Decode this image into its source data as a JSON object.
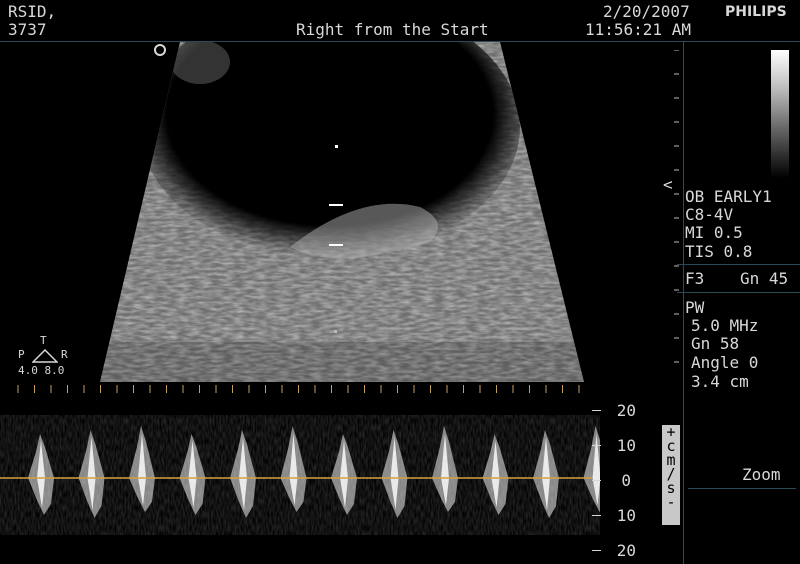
{
  "header": {
    "rsid_label": "RSID,",
    "rsid_value": "3737",
    "title": "Right from the Start",
    "date": "2/20/2007",
    "time": "11:56:21 AM",
    "brand": "PHILIPS"
  },
  "orientation": {
    "top": "T",
    "left": "P",
    "right": "R",
    "values": "4.0 8.0"
  },
  "settings": {
    "preset": "OB EARLY1",
    "transducer": "C8-4V",
    "mi": "MI 0.5",
    "tis": "TIS 0.8",
    "freq_mode": "F3",
    "gain2d": "Gn 45",
    "mode": "PW",
    "pw_freq": "5.0 MHz",
    "pw_gain": "Gn 58",
    "angle": "Angle 0",
    "depth": "3.4 cm",
    "zoom_label": "Zoom",
    "focus_marker": "<"
  },
  "doppler": {
    "scale_labels": [
      "20",
      "10",
      "0",
      "10",
      "20"
    ],
    "unit_chars": [
      "+",
      "c",
      "m",
      "/",
      "s",
      "-"
    ],
    "baseline_color": "#d8a040"
  },
  "icons": {
    "probe_marker": "circle-marker-icon",
    "orientation": "triangle-orientation-icon"
  }
}
